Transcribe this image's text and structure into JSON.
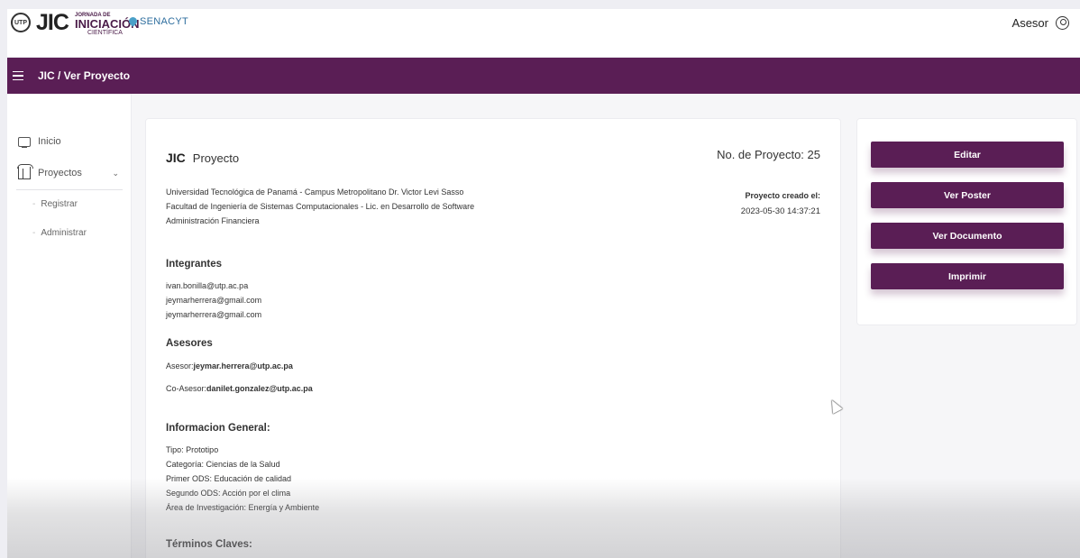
{
  "header": {
    "brand_jic": "JIC",
    "brand_jornada": "JORNADA DE",
    "brand_iniciacion": "INICIACIÓN",
    "brand_cientifica": "CIENTÍFICA",
    "brand_senacyt": "SENACYT",
    "user_label": "Asesor"
  },
  "navbar": {
    "breadcrumb": "JIC / Ver Proyecto"
  },
  "sidebar": {
    "items": [
      {
        "label": "Inicio",
        "icon": "monitor-icon"
      },
      {
        "label": "Proyectos",
        "icon": "columns-icon"
      }
    ],
    "subitems": [
      {
        "label": "Registrar"
      },
      {
        "label": "Administrar"
      }
    ]
  },
  "project": {
    "jic_label": "JIC",
    "title_word": "Proyecto",
    "number_label": "No. de Proyecto:",
    "number_value": "25",
    "university": "Universidad Tecnológica de Panamá - Campus Metropolitano Dr. Victor Levi Sasso",
    "faculty": "Facultad de Ingeniería de Sistemas Computacionales - Lic. en Desarrollo de Software",
    "name": "Administración Financiera",
    "created_label": "Proyecto creado el:",
    "created_date": "2023-05-30 14:37:21",
    "integrantes_title": "Integrantes",
    "integrantes": [
      "ivan.bonilla@utp.ac.pa",
      "jeymarherrera@gmail.com",
      "jeymarherrera@gmail.com"
    ],
    "asesores_title": "Asesores",
    "asesor_label": "Asesor:",
    "asesor_value": "jeymar.herrera@utp.ac.pa",
    "coasesor_label": "Co-Asesor:",
    "coasesor_value": "danilet.gonzalez@utp.ac.pa",
    "info_title": "Informacion General:",
    "info_lines": [
      "Tipo: Prototipo",
      "Categoría: Ciencias de la Salud",
      "Primer ODS: Educación de calidad",
      "Segundo ODS: Acción por el clima",
      "Área de Investigación: Energía y Ambiente"
    ],
    "keywords_title": "Términos Claves:"
  },
  "actions": {
    "edit": "Editar",
    "poster": "Ver Poster",
    "document": "Ver Documento",
    "print": "Imprimir"
  },
  "colors": {
    "brand_purple": "#5a1e55"
  }
}
